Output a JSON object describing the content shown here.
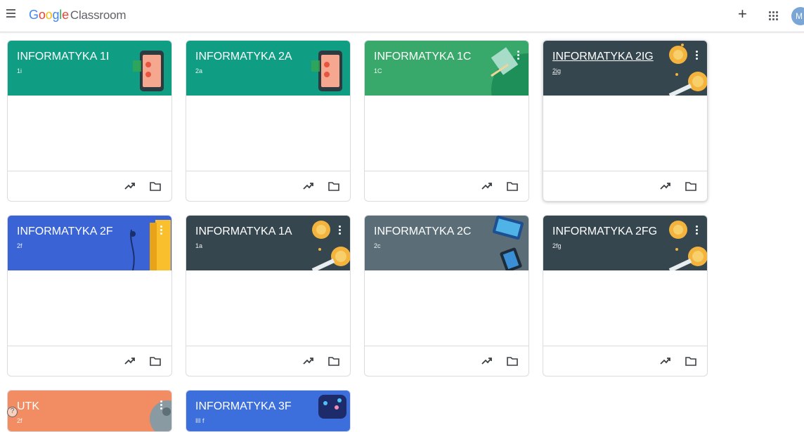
{
  "app": {
    "logo_google": [
      "G",
      "o",
      "o",
      "g",
      "l",
      "e"
    ],
    "logo_classroom": "Classroom",
    "menu_icon": "hamburger-menu-icon",
    "create_icon": "plus-icon",
    "create_label": "+",
    "apps_icon": "apps-grid-icon",
    "avatar_initial": "M"
  },
  "colors": {
    "teal": "#0f9d84",
    "green": "#38a96a",
    "dark": "#36464f",
    "blue": "#3a63d6",
    "slate": "#5b6e78",
    "orange": "#f28d63",
    "blue2": "#3d6fdc"
  },
  "cards": [
    {
      "title": "INFORMATYKA 1I",
      "section": "1i",
      "theme": "teal"
    },
    {
      "title": "INFORMATYKA 2A",
      "section": "2a",
      "theme": "teal"
    },
    {
      "title": "INFORMATYKA 1C",
      "section": "1C",
      "theme": "green"
    },
    {
      "title": "INFORMATYKA 2IG",
      "section": "2ig",
      "theme": "dark"
    },
    {
      "title": "INFORMATYKA 2F",
      "section": "2f",
      "theme": "blue"
    },
    {
      "title": "INFORMATYKA 1A",
      "section": "1a",
      "theme": "dark"
    },
    {
      "title": "INFORMATYKA 2C",
      "section": "2c",
      "theme": "slate"
    },
    {
      "title": "INFORMATYKA 2FG",
      "section": "2fg",
      "theme": "dark"
    },
    {
      "title": "UTK",
      "section": "2f",
      "theme": "orange"
    },
    {
      "title": "INFORMATYKA 3F",
      "section": "III f",
      "theme": "blue2"
    }
  ],
  "card_icons": {
    "stream": "trending-up-icon",
    "drive": "folder-icon"
  },
  "help_icon": "help-icon",
  "help_label": "?"
}
